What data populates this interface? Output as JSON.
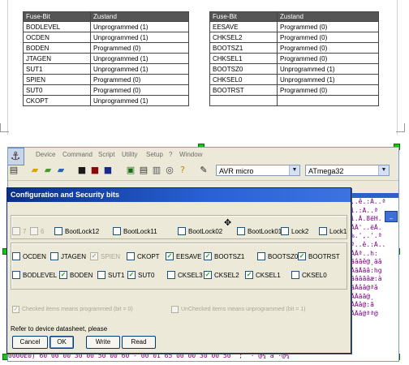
{
  "fuse_tables": {
    "left": {
      "headers": [
        "Fuse-Bit",
        "Zustand"
      ],
      "rows": [
        [
          "BODLEVEL",
          "Unprogrammed (1)"
        ],
        [
          "OCDEN",
          "Unprogrammed (1)"
        ],
        [
          "BODEN",
          "Programmed (0)"
        ],
        [
          "JTAGEN",
          "Unprogrammed (1)"
        ],
        [
          "SUT1",
          "Unprogrammed (1)"
        ],
        [
          "SPIEN",
          "Programmed (0)"
        ],
        [
          "SUT0",
          "Programmed (0)"
        ],
        [
          "CKOPT",
          "Unprogrammed (1)"
        ]
      ]
    },
    "right": {
      "headers": [
        "Fuse-Bit",
        "Zustand"
      ],
      "rows": [
        [
          "EESAVE",
          "Programmed (0)"
        ],
        [
          "CHKSEL2",
          "Programmed (0)"
        ],
        [
          "BOOTSZ1",
          "Programmed (0)"
        ],
        [
          "CHKSEL1",
          "Programmed (0)"
        ],
        [
          "BOOTSZ0",
          "Unprogrammed (1)"
        ],
        [
          "CHKSEL0",
          "Unprogrammed (1)"
        ],
        [
          "BOOTRST",
          "Programmed (0)"
        ],
        [
          "",
          ""
        ]
      ]
    }
  },
  "app": {
    "menu": [
      "Device",
      "Command",
      "Script",
      "Utility",
      "Setup",
      "?",
      "Window"
    ],
    "programmer_combo": "AVR micro",
    "device_combo": "ATmega32",
    "hex_right": [
      "..ê.:Á..ª",
      "i.:Á..ª",
      "i.Â.8ëH.",
      "ÃÃ'..ëÃ.",
      "%.',.'.ª",
      "ª..ê.:Á..",
      "ÃÃª..h:",
      "ãâãê@¸äâ",
      "ÃãÃãâ:hg",
      "ãâããâæ:à",
      "ãÃââ@ªâ",
      "ÃÃãã@¸",
      "ÃÃâ@:ã",
      "ÃÃâ@ªª@"
    ],
    "hex_bottom": "0000E0) 60 00 00 30 00 50 00 60 - 00 01 65 00 00 30 00 50  ;  · @¼ à ·@¼"
  },
  "dialog": {
    "title": "Configuration and Security bits",
    "row1": [
      {
        "label": "7",
        "checked": false,
        "disabled": true
      },
      {
        "label": "6",
        "checked": false,
        "disabled": true
      },
      {
        "label": "BootLock12",
        "checked": false,
        "disabled": false
      },
      {
        "label": "BootLock11",
        "checked": false,
        "disabled": false
      },
      {
        "label": "BootLock02",
        "checked": false,
        "disabled": false
      },
      {
        "label": "BootLock01",
        "checked": false,
        "disabled": false
      },
      {
        "label": "Lock2",
        "checked": false,
        "disabled": false
      },
      {
        "label": "Lock1",
        "checked": false,
        "disabled": false
      }
    ],
    "row2": [
      {
        "label": "OCDEN",
        "checked": false,
        "disabled": false
      },
      {
        "label": "JTAGEN",
        "checked": false,
        "disabled": false
      },
      {
        "label": "SPIEN",
        "checked": true,
        "disabled": true
      },
      {
        "label": "CKOPT",
        "checked": false,
        "disabled": false
      },
      {
        "label": "EESAVE",
        "checked": true,
        "disabled": false
      },
      {
        "label": "BOOTSZ1",
        "checked": true,
        "disabled": false
      },
      {
        "label": "BOOTSZ0",
        "checked": false,
        "disabled": false
      },
      {
        "label": "BOOTRST",
        "checked": true,
        "disabled": false
      }
    ],
    "row3": [
      {
        "label": "BODLEVEL",
        "checked": false,
        "disabled": false
      },
      {
        "label": "BODEN",
        "checked": true,
        "disabled": false
      },
      {
        "label": "SUT1",
        "checked": false,
        "disabled": false
      },
      {
        "label": "SUT0",
        "checked": true,
        "disabled": false
      },
      {
        "label": "CKSEL3",
        "checked": false,
        "disabled": false
      },
      {
        "label": "CKSEL2",
        "checked": true,
        "disabled": false
      },
      {
        "label": "CKSEL1",
        "checked": true,
        "disabled": false
      },
      {
        "label": "CKSEL0",
        "checked": false,
        "disabled": false
      }
    ],
    "note_checked": "Checked items means programmed (bit = 0)",
    "note_unchecked": "UnChecked items means unprogrammed (bit = 1)",
    "refer": "Refer to device datasheet, please",
    "buttons": {
      "cancel": "Cancel",
      "ok": "OK",
      "write": "Write",
      "read": "Read"
    }
  }
}
